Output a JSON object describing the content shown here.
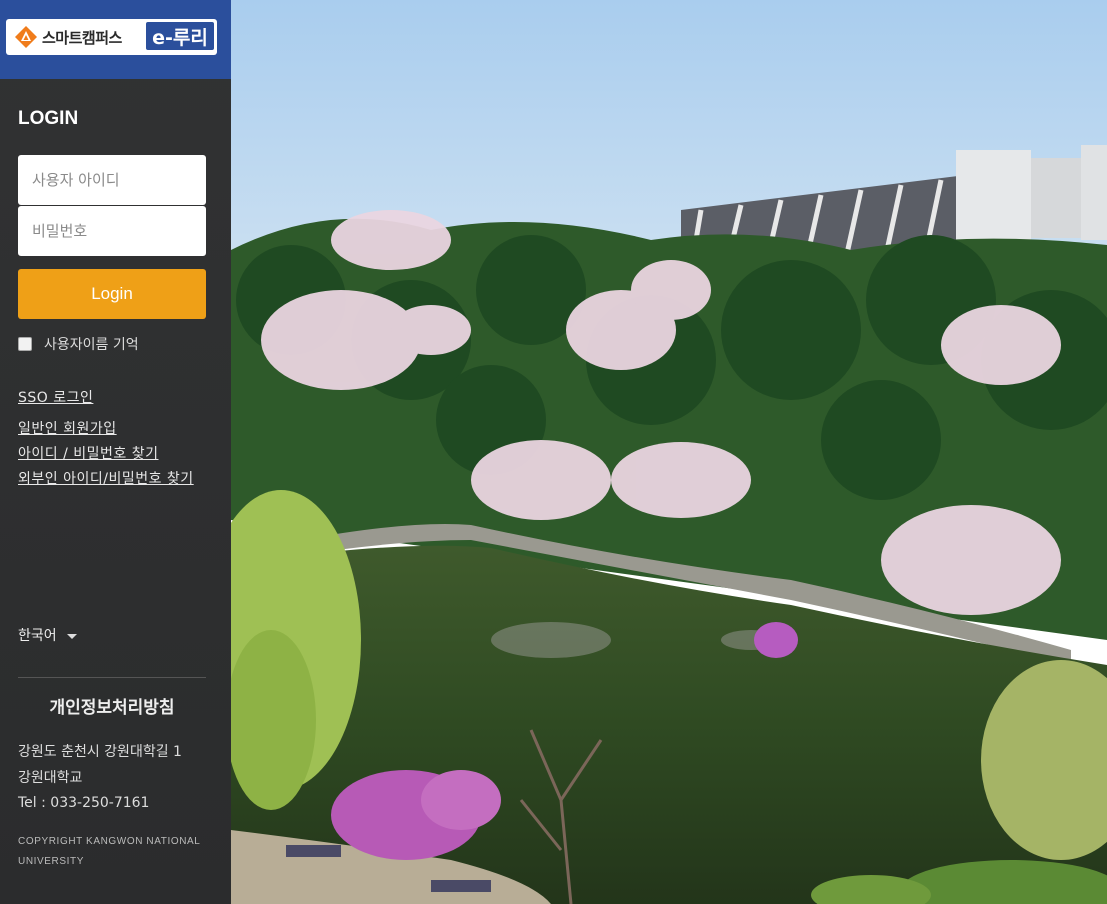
{
  "brand": {
    "logo_text": "스마트캠퍼스",
    "logo_badge": "e-루리",
    "brand_color": "#2b4f9c"
  },
  "login": {
    "title": "LOGIN",
    "username_placeholder": "사용자 아이디",
    "password_placeholder": "비밀번호",
    "button_label": "Login",
    "button_color": "#efa017",
    "remember_label": "사용자이름 기억"
  },
  "links": {
    "sso": "SSO 로그인",
    "signup": "일반인 회원가입",
    "find_id_pw": "아이디 / 비밀번호 찾기",
    "find_external": "외부인 아이디/비밀번호 찾기"
  },
  "language": {
    "selected": "한국어"
  },
  "footer": {
    "privacy": "개인정보처리방침",
    "address_line1": "강원도 춘천시 강원대학길 1",
    "address_line2": "강원대학교",
    "tel": "Tel : 033-250-7161",
    "copyright": "COPYRIGHT KANGWON NATIONAL UNIVERSITY"
  },
  "background": {
    "icon": "campus-landscape-photo"
  }
}
